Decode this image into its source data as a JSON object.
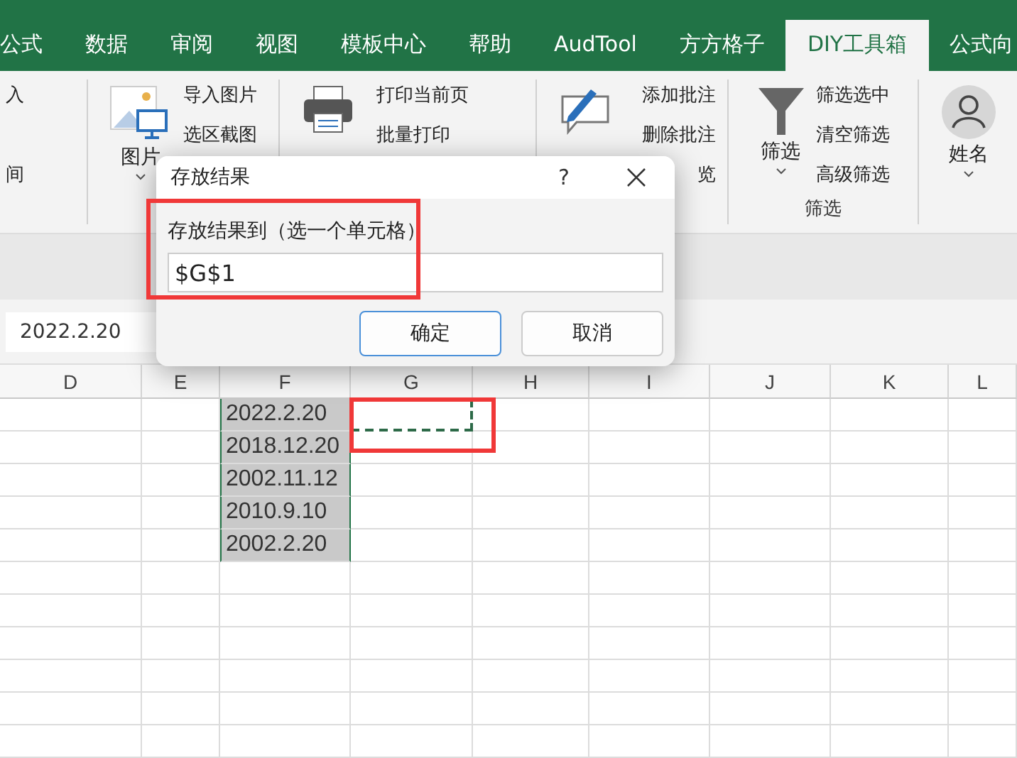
{
  "tabs": [
    {
      "label": "公式",
      "selected": false
    },
    {
      "label": "数据",
      "selected": false
    },
    {
      "label": "审阅",
      "selected": false
    },
    {
      "label": "视图",
      "selected": false
    },
    {
      "label": "模板中心",
      "selected": false
    },
    {
      "label": "帮助",
      "selected": false
    },
    {
      "label": "AudTool",
      "selected": false
    },
    {
      "label": "方方格子",
      "selected": false
    },
    {
      "label": "DIY工具箱",
      "selected": true
    },
    {
      "label": "公式向",
      "selected": false
    }
  ],
  "ribbon": {
    "groups": [
      {
        "kind": "list",
        "items": [
          "入",
          "间"
        ]
      },
      {
        "kind": "picture",
        "label": "图片",
        "items": [
          "导入图片",
          "选区截图"
        ]
      },
      {
        "kind": "printer",
        "items": [
          "打印当前页",
          "批量打印"
        ]
      },
      {
        "kind": "comment",
        "items": [
          "添加批注",
          "删除批注",
          "览"
        ]
      },
      {
        "kind": "filter",
        "label": "筛选",
        "items": [
          "筛选选中",
          "清空筛选",
          "高级筛选"
        ],
        "caption": "筛选"
      },
      {
        "kind": "person",
        "label": "姓名"
      }
    ]
  },
  "name_box": "2022.2.20",
  "columns": [
    "D",
    "E",
    "F",
    "G",
    "H",
    "I",
    "J",
    "K",
    "L"
  ],
  "rows": [
    {
      "value": "2022.2.20",
      "selected": true,
      "marquee": true
    },
    {
      "value": "2018.12.20",
      "selected": true,
      "marquee": false
    },
    {
      "value": "2002.11.12",
      "selected": true,
      "marquee": false
    },
    {
      "value": "2010.9.10",
      "selected": true,
      "marquee": false
    },
    {
      "value": "2002.2.20",
      "selected": true,
      "marquee": false
    }
  ],
  "dialog": {
    "title": "存放结果",
    "help": "?",
    "label": "存放结果到（选一个单元格）",
    "value": "$G$1",
    "buttons": [
      {
        "label": "确定",
        "default": true
      },
      {
        "label": "取消",
        "default": false
      }
    ]
  }
}
